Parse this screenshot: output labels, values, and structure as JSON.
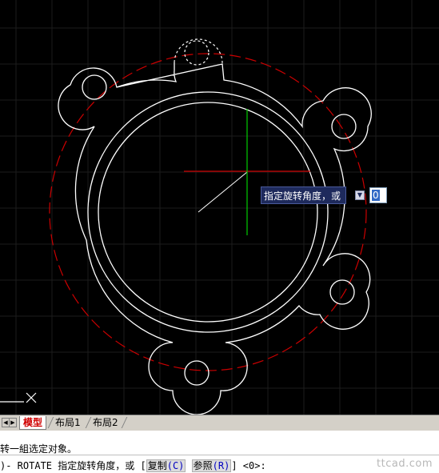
{
  "drawing": {
    "dynamic_prompt": "指定旋转角度，或",
    "dynamic_value": "0"
  },
  "tabs": [
    {
      "label": "模型",
      "active": true
    },
    {
      "label": "布局1",
      "active": false
    },
    {
      "label": "布局2",
      "active": false
    }
  ],
  "command": {
    "history_line": "转一組选定对象。",
    "prompt_prefix": ")- ROTATE 指定旋转角度，或 [",
    "option1_label": "复制",
    "option1_key": "(C)",
    "option2_label": "参照",
    "option2_key": "(R)",
    "prompt_suffix": "] <0>:",
    "watermark": "ttcad.com"
  },
  "colors": {
    "background": "#000000",
    "geometry": "#ffffff",
    "rotation_path": "#cc0000",
    "cursor_x": "#cc0000",
    "cursor_y": "#00cc00"
  }
}
